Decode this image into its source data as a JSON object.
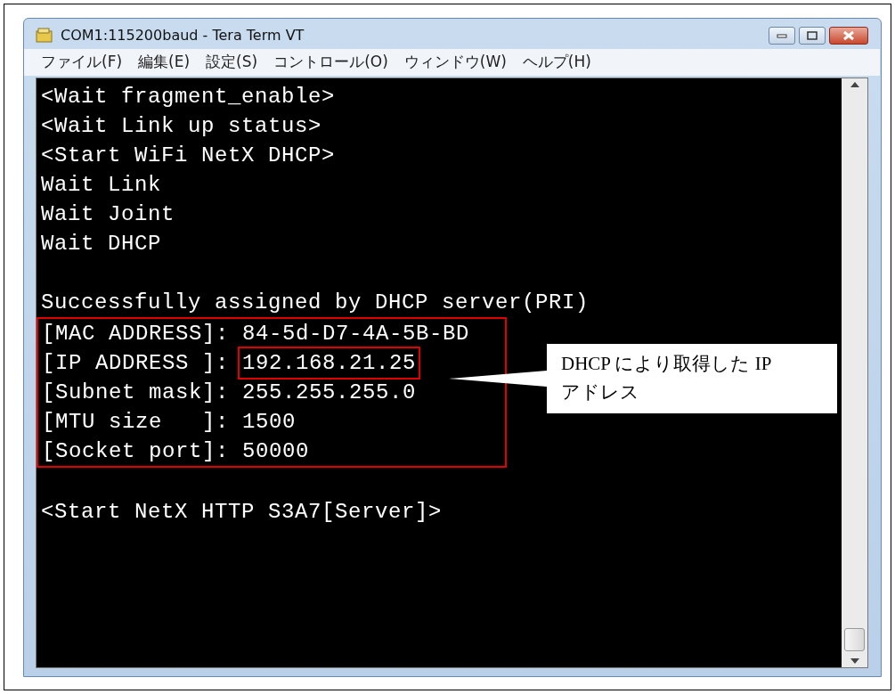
{
  "window": {
    "title": "COM1:115200baud - Tera Term VT"
  },
  "menu": [
    "ファイル(F)",
    "編集(E)",
    "設定(S)",
    "コントロール(O)",
    "ウィンドウ(W)",
    "ヘルプ(H)"
  ],
  "terminal": {
    "log_lines": [
      "<Wait fragment_enable>",
      "<Wait Link up status>",
      "<Start WiFi NetX DHCP>",
      "Wait Link",
      "Wait Joint",
      "Wait DHCP"
    ],
    "status_line": "Successfully assigned by DHCP server(PRI)",
    "details": [
      {
        "label": "[MAC ADDRESS]:",
        "value": "84-5d-D7-4A-5B-BD",
        "highlighted": false
      },
      {
        "label": "[IP ADDRESS ]:",
        "value": "192.168.21.25",
        "highlighted": true
      },
      {
        "label": "[Subnet mask]:",
        "value": "255.255.255.0",
        "highlighted": false
      },
      {
        "label": "[MTU size   ]:",
        "value": "1500",
        "highlighted": false
      },
      {
        "label": "[Socket port]:",
        "value": "50000",
        "highlighted": false
      }
    ],
    "final_lines": [
      "<Start NetX HTTP S3A7[Server]>"
    ]
  },
  "callout": {
    "text": "DHCP により取得した IP アドレス"
  }
}
